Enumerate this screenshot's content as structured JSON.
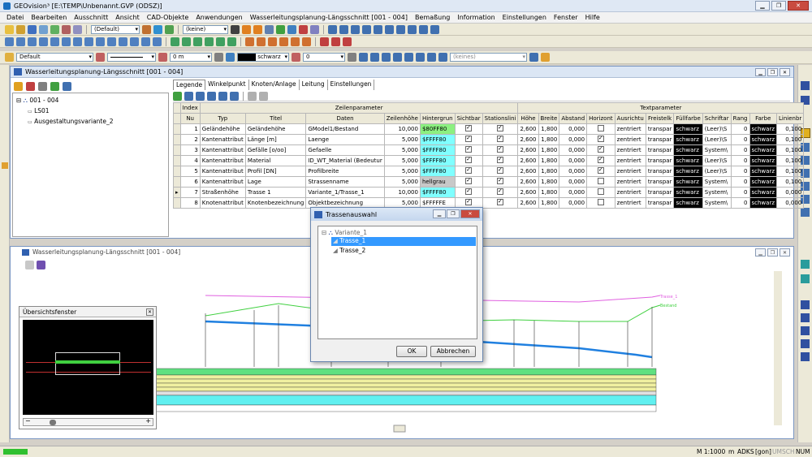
{
  "app": {
    "title": "GEOvision³  [E:\\TEMP\\Unbenannt.GVP (ODSZ)]"
  },
  "menu": [
    "Datei",
    "Bearbeiten",
    "Ausschnitt",
    "Ansicht",
    "CAD-Objekte",
    "Anwendungen",
    "Wasserleitungsplanung-Längsschnitt [001 - 004]",
    "Bemaßung",
    "Information",
    "Einstellungen",
    "Fenster",
    "Hilfe"
  ],
  "toolbar1": {
    "layer_combo": "(Default)",
    "line_combo": "(keine)"
  },
  "toolbar3": {
    "style_combo": "Default",
    "offset": "0 m",
    "color": "schwarz",
    "value": "0",
    "none_combo": "(keines)"
  },
  "window_top": {
    "title": "Wasserleitungsplanung-Längsschnitt [001 - 004]",
    "tree": {
      "root": "001 - 004",
      "child1": "LS01",
      "child2": "Ausgestaltungsvariante_2"
    },
    "tabs": [
      "Legende",
      "Winkelpunkt",
      "Knoten/Anlage",
      "Leitung",
      "Einstellungen"
    ],
    "group_headers": {
      "index": "Index",
      "zeilen": "Zeilenparameter",
      "text": "Textparameter"
    },
    "columns": [
      "Nu",
      "Typ",
      "Titel",
      "Daten",
      "Zeilenhöhe",
      "Hintergrun",
      "Sichtbar",
      "Stationslini",
      "Höhe",
      "Breite",
      "Abstand",
      "Horizont",
      "Ausrichtu",
      "Freistelk",
      "Füllfarbe",
      "Schriftar",
      "Rang",
      "Farbe",
      "Linienbr"
    ],
    "rows": [
      {
        "nu": "1",
        "typ": "Geländehöhe",
        "titel": "Geländehöhe",
        "daten": "GModel1/Bestand",
        "zh": "10,000",
        "bg": "$80FF80",
        "hoehe": "2,600",
        "breite": "1,800",
        "abstand": "0,000",
        "ausr": "zentriert",
        "frei": "transpar",
        "fuell": "schwarz",
        "schrift": "(Leer)\\S",
        "rang": "0",
        "farbe": "schwarz",
        "lb": "0,100"
      },
      {
        "nu": "2",
        "typ": "Kantenattribut",
        "titel": "Länge [m]",
        "daten": "Laenge",
        "zh": "5,000",
        "bg": "$FFFF80",
        "hoehe": "2,600",
        "breite": "1,800",
        "abstand": "0,000",
        "ausr": "zentriert",
        "frei": "transpar",
        "fuell": "schwarz",
        "schrift": "(Leer)\\S",
        "rang": "0",
        "farbe": "schwarz",
        "lb": "0,100"
      },
      {
        "nu": "3",
        "typ": "Kantenattribut",
        "titel": "Gefälle [o/oo]",
        "daten": "Gefaelle",
        "zh": "5,000",
        "bg": "$FFFF80",
        "hoehe": "2,600",
        "breite": "1,800",
        "abstand": "0,000",
        "ausr": "zentriert",
        "frei": "transpar",
        "fuell": "schwarz",
        "schrift": "System\\",
        "rang": "0",
        "farbe": "schwarz",
        "lb": "0,100"
      },
      {
        "nu": "4",
        "typ": "Kantenattribut",
        "titel": "Material",
        "daten": "ID_WT_Material (Bedeutur",
        "zh": "5,000",
        "bg": "$FFFF80",
        "hoehe": "2,600",
        "breite": "1,800",
        "abstand": "0,000",
        "ausr": "zentriert",
        "frei": "transpar",
        "fuell": "schwarz",
        "schrift": "(Leer)\\S",
        "rang": "0",
        "farbe": "schwarz",
        "lb": "0,100"
      },
      {
        "nu": "5",
        "typ": "Kantenattribut",
        "titel": "Profil [DN]",
        "daten": "Profilbreite",
        "zh": "5,000",
        "bg": "$FFFF80",
        "hoehe": "2,600",
        "breite": "1,800",
        "abstand": "0,000",
        "ausr": "zentriert",
        "frei": "transpar",
        "fuell": "schwarz",
        "schrift": "(Leer)\\S",
        "rang": "0",
        "farbe": "schwarz",
        "lb": "0,100"
      },
      {
        "nu": "6",
        "typ": "Kantenattribut",
        "titel": "Lage",
        "daten": "Strassenname",
        "zh": "5,000",
        "bg": "hellgrau",
        "hoehe": "2,600",
        "breite": "1,800",
        "abstand": "0,000",
        "ausr": "zentriert",
        "frei": "transpar",
        "fuell": "schwarz",
        "schrift": "System\\",
        "rang": "0",
        "farbe": "schwarz",
        "lb": "0,100"
      },
      {
        "nu": "7",
        "typ": "Straßenhöhe",
        "titel": "Trasse 1",
        "daten": "Variante_1/Trasse_1",
        "zh": "10,000",
        "bg": "$FFFF80",
        "hoehe": "2,600",
        "breite": "1,800",
        "abstand": "0,000",
        "ausr": "zentriert",
        "frei": "transpar",
        "fuell": "schwarz",
        "schrift": "System\\",
        "rang": "0",
        "farbe": "schwarz",
        "lb": "0,000"
      },
      {
        "nu": "8",
        "typ": "Knotenattribut",
        "titel": "Knotenbezeichnung",
        "daten": "Objektbezeichnung",
        "zh": "5,000",
        "bg": "$FFFFFE",
        "hoehe": "2,600",
        "breite": "1,800",
        "abstand": "0,000",
        "ausr": "zentriert",
        "frei": "transpar",
        "fuell": "schwarz",
        "schrift": "System\\",
        "rang": "0",
        "farbe": "schwarz",
        "lb": "0,000"
      }
    ]
  },
  "window_bottom": {
    "title": "Wasserleitungsplanung-Längsschnitt [001 - 004]",
    "label_trasse": "Trasse_1",
    "label_bestand": "Bestand"
  },
  "overview": {
    "title": "Übersichtsfenster"
  },
  "dialog": {
    "title": "Trassenauswahl",
    "root": "Variante_1",
    "items": [
      "Trasse_1",
      "Trasse_2"
    ],
    "ok": "OK",
    "cancel": "Abbrechen"
  },
  "status": {
    "scale": "M 1:1000",
    "unit": "m",
    "adks": "ADKS",
    "gon": "[gon]",
    "umsch": "UMSCH",
    "num": "NUM"
  }
}
